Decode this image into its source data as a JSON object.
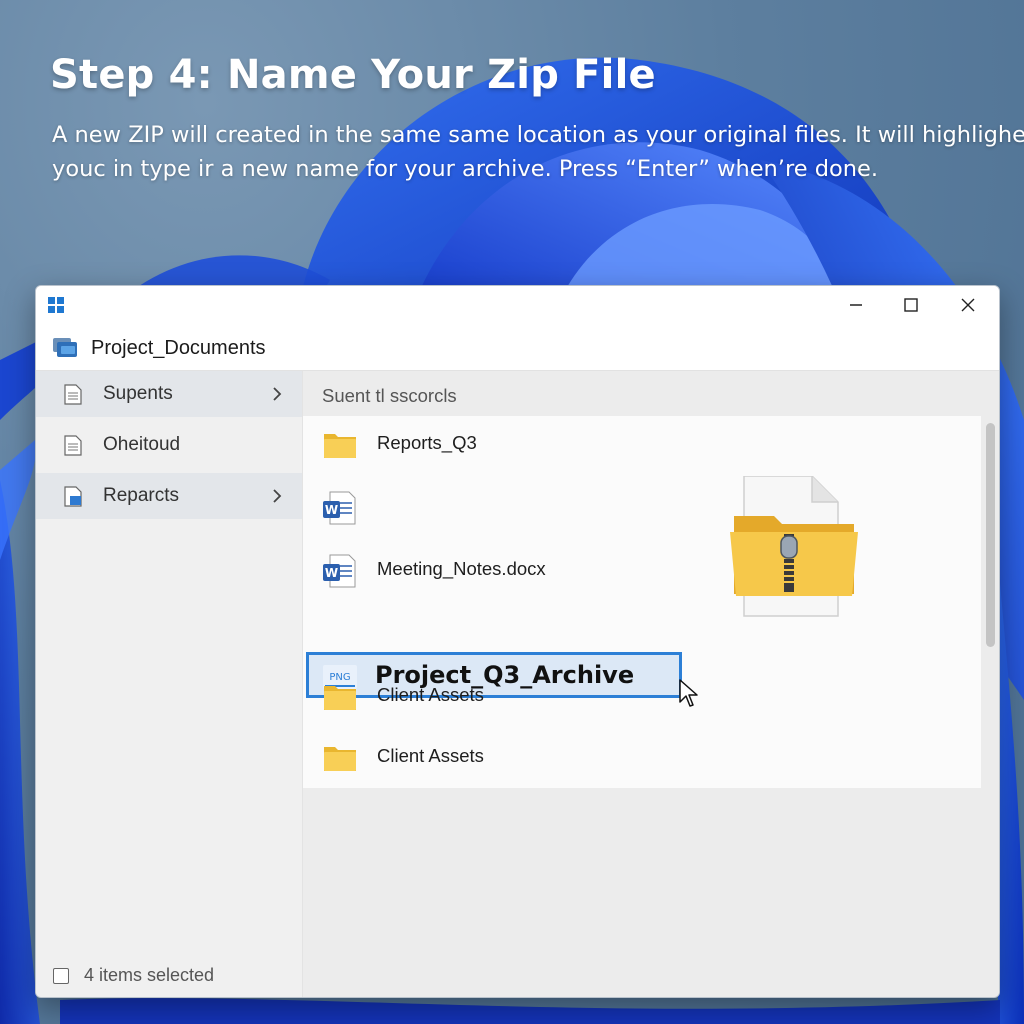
{
  "tutorial": {
    "title": "Step 4: Name Your Zip File",
    "description_line1": "A new ZIP will created in the same same location as your original files. It will highlighed",
    "description_line2": "youc in type ir a new name for your archive. Press “Enter” when’re done."
  },
  "window": {
    "controls": [
      "minimize-icon",
      "maximize-icon",
      "close-icon"
    ],
    "address": "Project_Documents"
  },
  "sidebar": {
    "items": [
      {
        "label": "Supents",
        "icon": "document-icon",
        "has_chevron": true,
        "selected": true
      },
      {
        "label": "Oheitoud",
        "icon": "document-icon",
        "has_chevron": false,
        "selected": false
      },
      {
        "label": "Reparcts",
        "icon": "pictures-icon",
        "has_chevron": true,
        "selected": true
      }
    ]
  },
  "content": {
    "header": "Suent tl sscorcls",
    "files": [
      {
        "name": "Reports_Q3",
        "icon": "folder-icon"
      },
      {
        "name": "",
        "icon": "word-document-icon"
      },
      {
        "name": "Meeting_Notes.docx",
        "icon": "word-document-icon"
      },
      {
        "name": "Project_Q3_Archive",
        "icon": "png-file-icon",
        "renaming": true,
        "icon_label": "PNG"
      },
      {
        "name": "Client Assets",
        "icon": "folder-icon"
      },
      {
        "name": "Client Assets",
        "icon": "folder-icon"
      }
    ]
  },
  "status": {
    "text": "4 items selected"
  },
  "colors": {
    "accent": "#2c7fd6",
    "rename_background": "#dce8f6",
    "folder": "#f5c542"
  }
}
